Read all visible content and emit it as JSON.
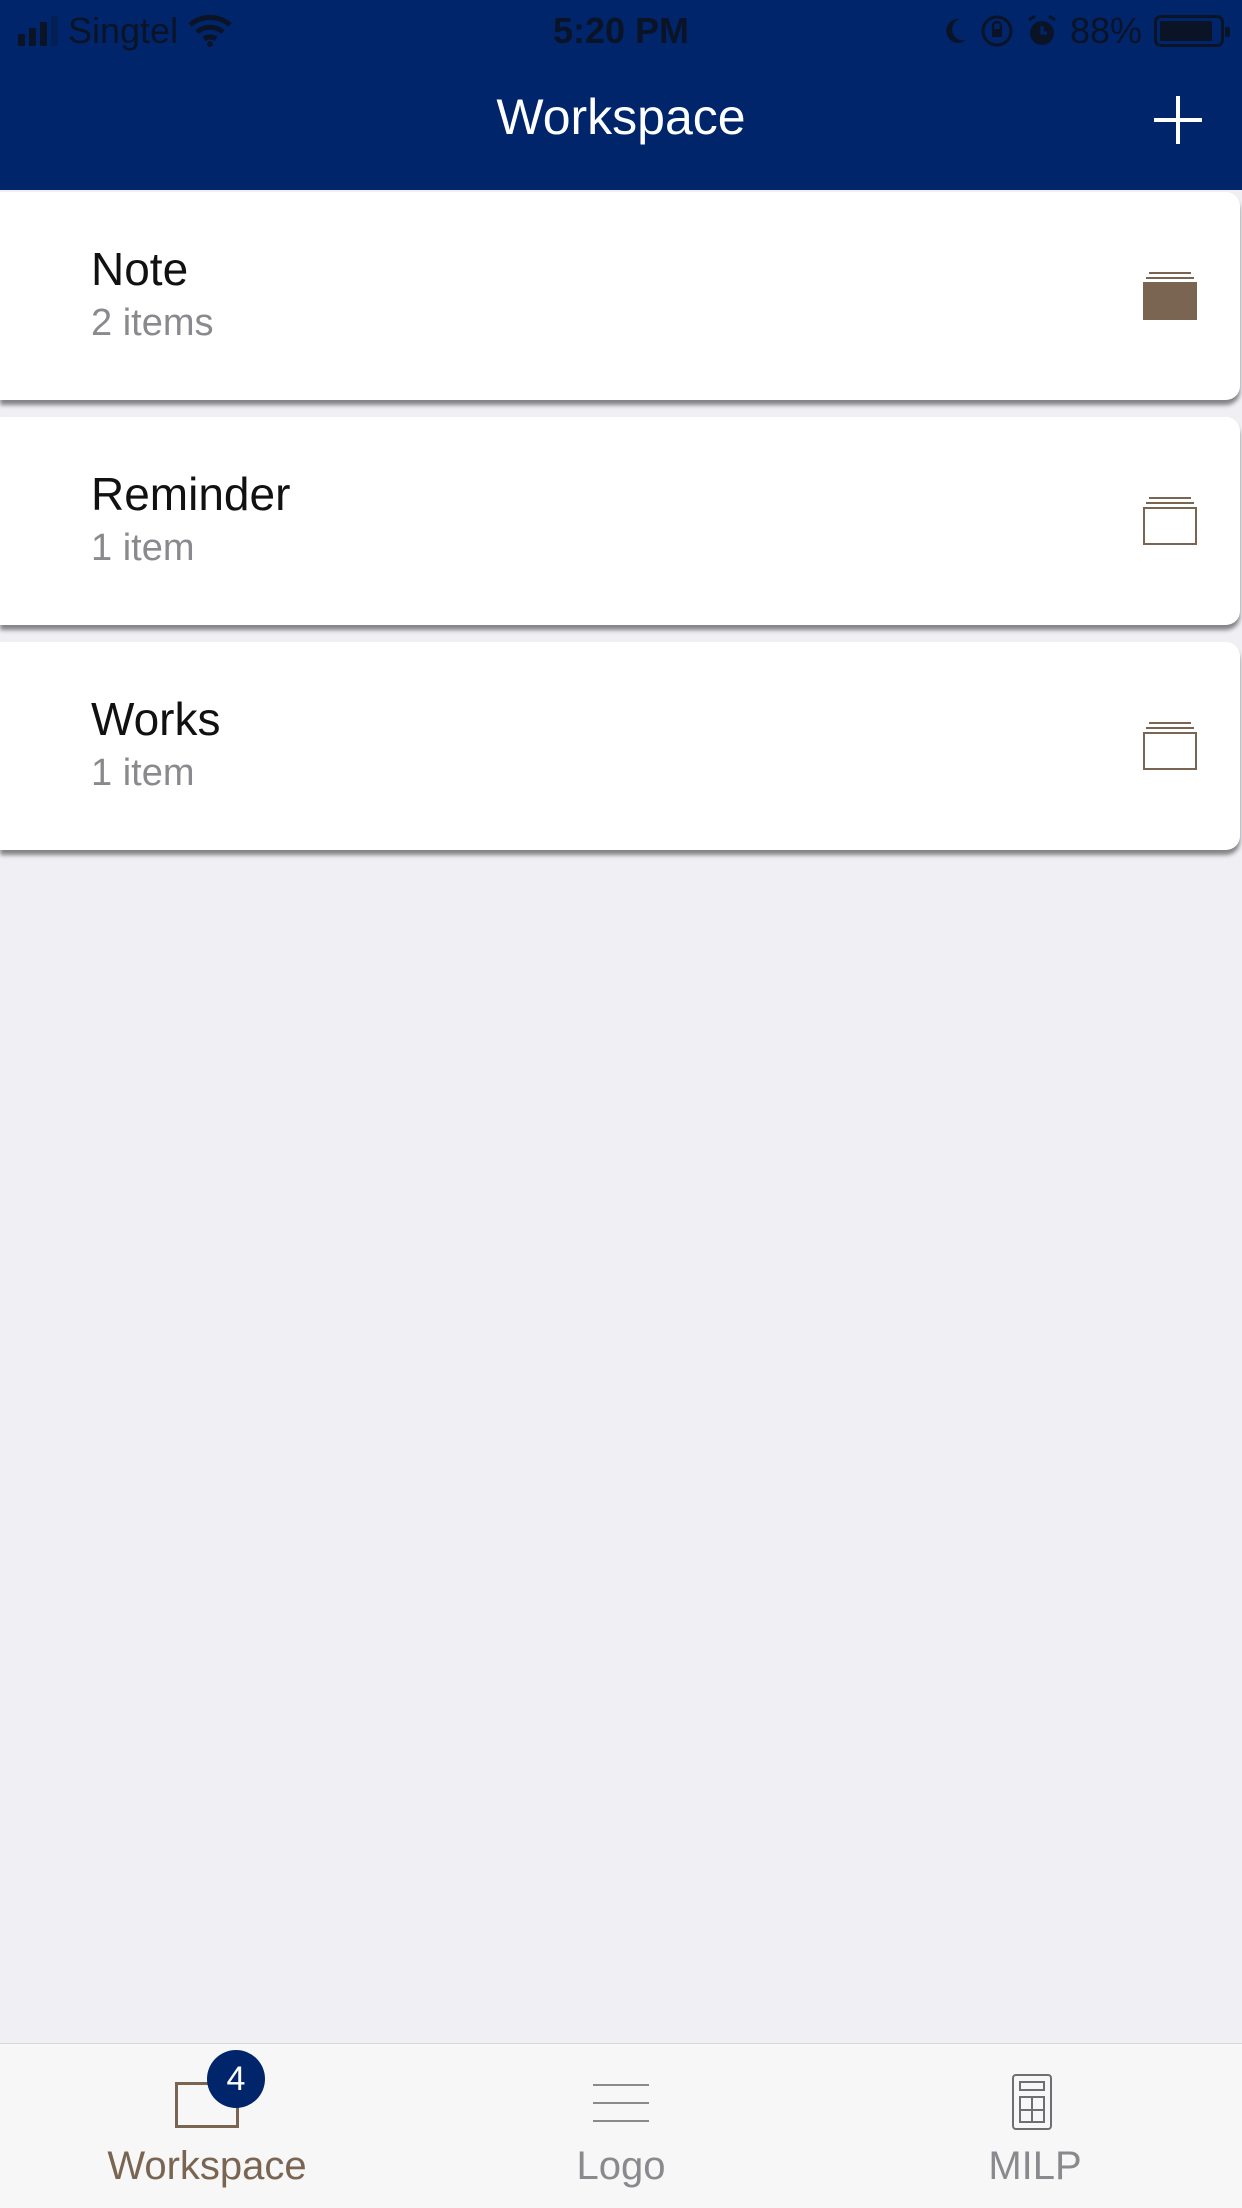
{
  "status_bar": {
    "carrier": "Singtel",
    "time": "5:20 PM",
    "battery": "88%",
    "icons": [
      "signal-icon",
      "wifi-icon",
      "moon-icon",
      "orientation-lock-icon",
      "alarm-icon",
      "battery-icon"
    ]
  },
  "nav": {
    "title": "Workspace",
    "add_icon": "plus-icon"
  },
  "folders": [
    {
      "title": "Note",
      "subtitle": "2 items",
      "icon": "folder-filled-icon"
    },
    {
      "title": "Reminder",
      "subtitle": "1 item",
      "icon": "folder-outline-icon"
    },
    {
      "title": "Works",
      "subtitle": "1 item",
      "icon": "folder-outline-icon"
    }
  ],
  "tabbar": {
    "tabs": [
      {
        "label": "Workspace",
        "icon": "folder-icon",
        "badge": "4",
        "selected": true
      },
      {
        "label": "Logo",
        "icon": "menu-lines-icon",
        "selected": false
      },
      {
        "label": "MILP",
        "icon": "calculator-icon",
        "selected": false
      }
    ]
  },
  "colors": {
    "nav_background": "#00256b",
    "accent_brown": "#7a6552",
    "page_background": "#efeff4"
  }
}
